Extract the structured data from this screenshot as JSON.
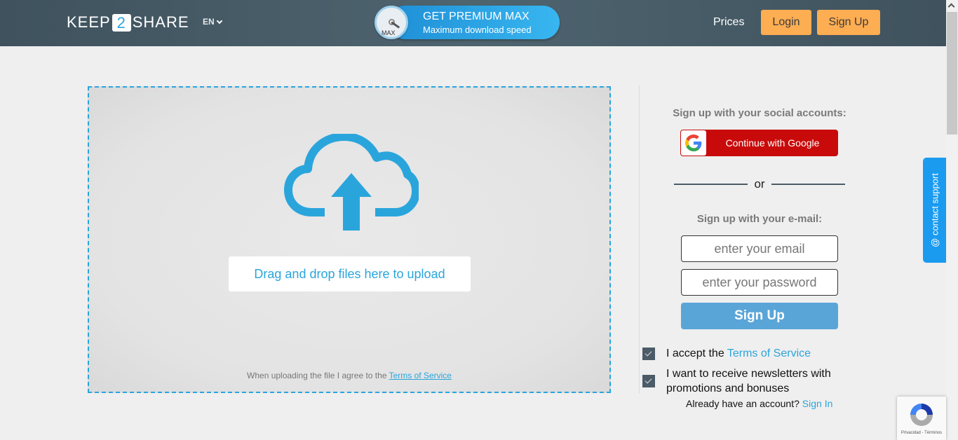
{
  "header": {
    "logo": {
      "left": "KEEP",
      "number": "2",
      "right": "SHARE"
    },
    "language": "EN",
    "premium": {
      "title": "GET PREMIUM MAX",
      "subtitle": "Maximum download speed",
      "gauge_label": "MAX"
    },
    "nav": {
      "prices": "Prices",
      "login": "Login",
      "signup": "Sign Up"
    }
  },
  "upload": {
    "drag_label": "Drag and drop files here to upload",
    "terms_prefix": "When uploading the file I agree to the",
    "terms_link": "Terms of Service",
    "icon": "cloud-upload-icon"
  },
  "signup": {
    "social_title": "Sign up with your social accounts:",
    "google_label": "Continue with Google",
    "or_text": "or",
    "email_title": "Sign up with your e-mail:",
    "email_placeholder": "enter your email",
    "email_value": "",
    "password_placeholder": "enter your password",
    "password_value": "",
    "submit_label": "Sign Up",
    "checkboxes": [
      {
        "prefix": "I accept the",
        "link": "Terms of Service",
        "checked": true
      },
      {
        "text": "I want to receive newsletters with promotions and bonuses",
        "checked": true
      }
    ],
    "already_text": "Already have an account?",
    "signin_link": "Sign In"
  },
  "support": {
    "label": "@ contact support"
  },
  "recaptcha": {
    "terms": "Privacidad - Términos"
  },
  "colors": {
    "accent": "#2aa5dc",
    "header_bg": "#4a5d68",
    "orange": "#fdad52",
    "google_red": "#c90a0a",
    "signup_blue": "#5aa5d8",
    "support_blue": "#1a9bf0"
  }
}
